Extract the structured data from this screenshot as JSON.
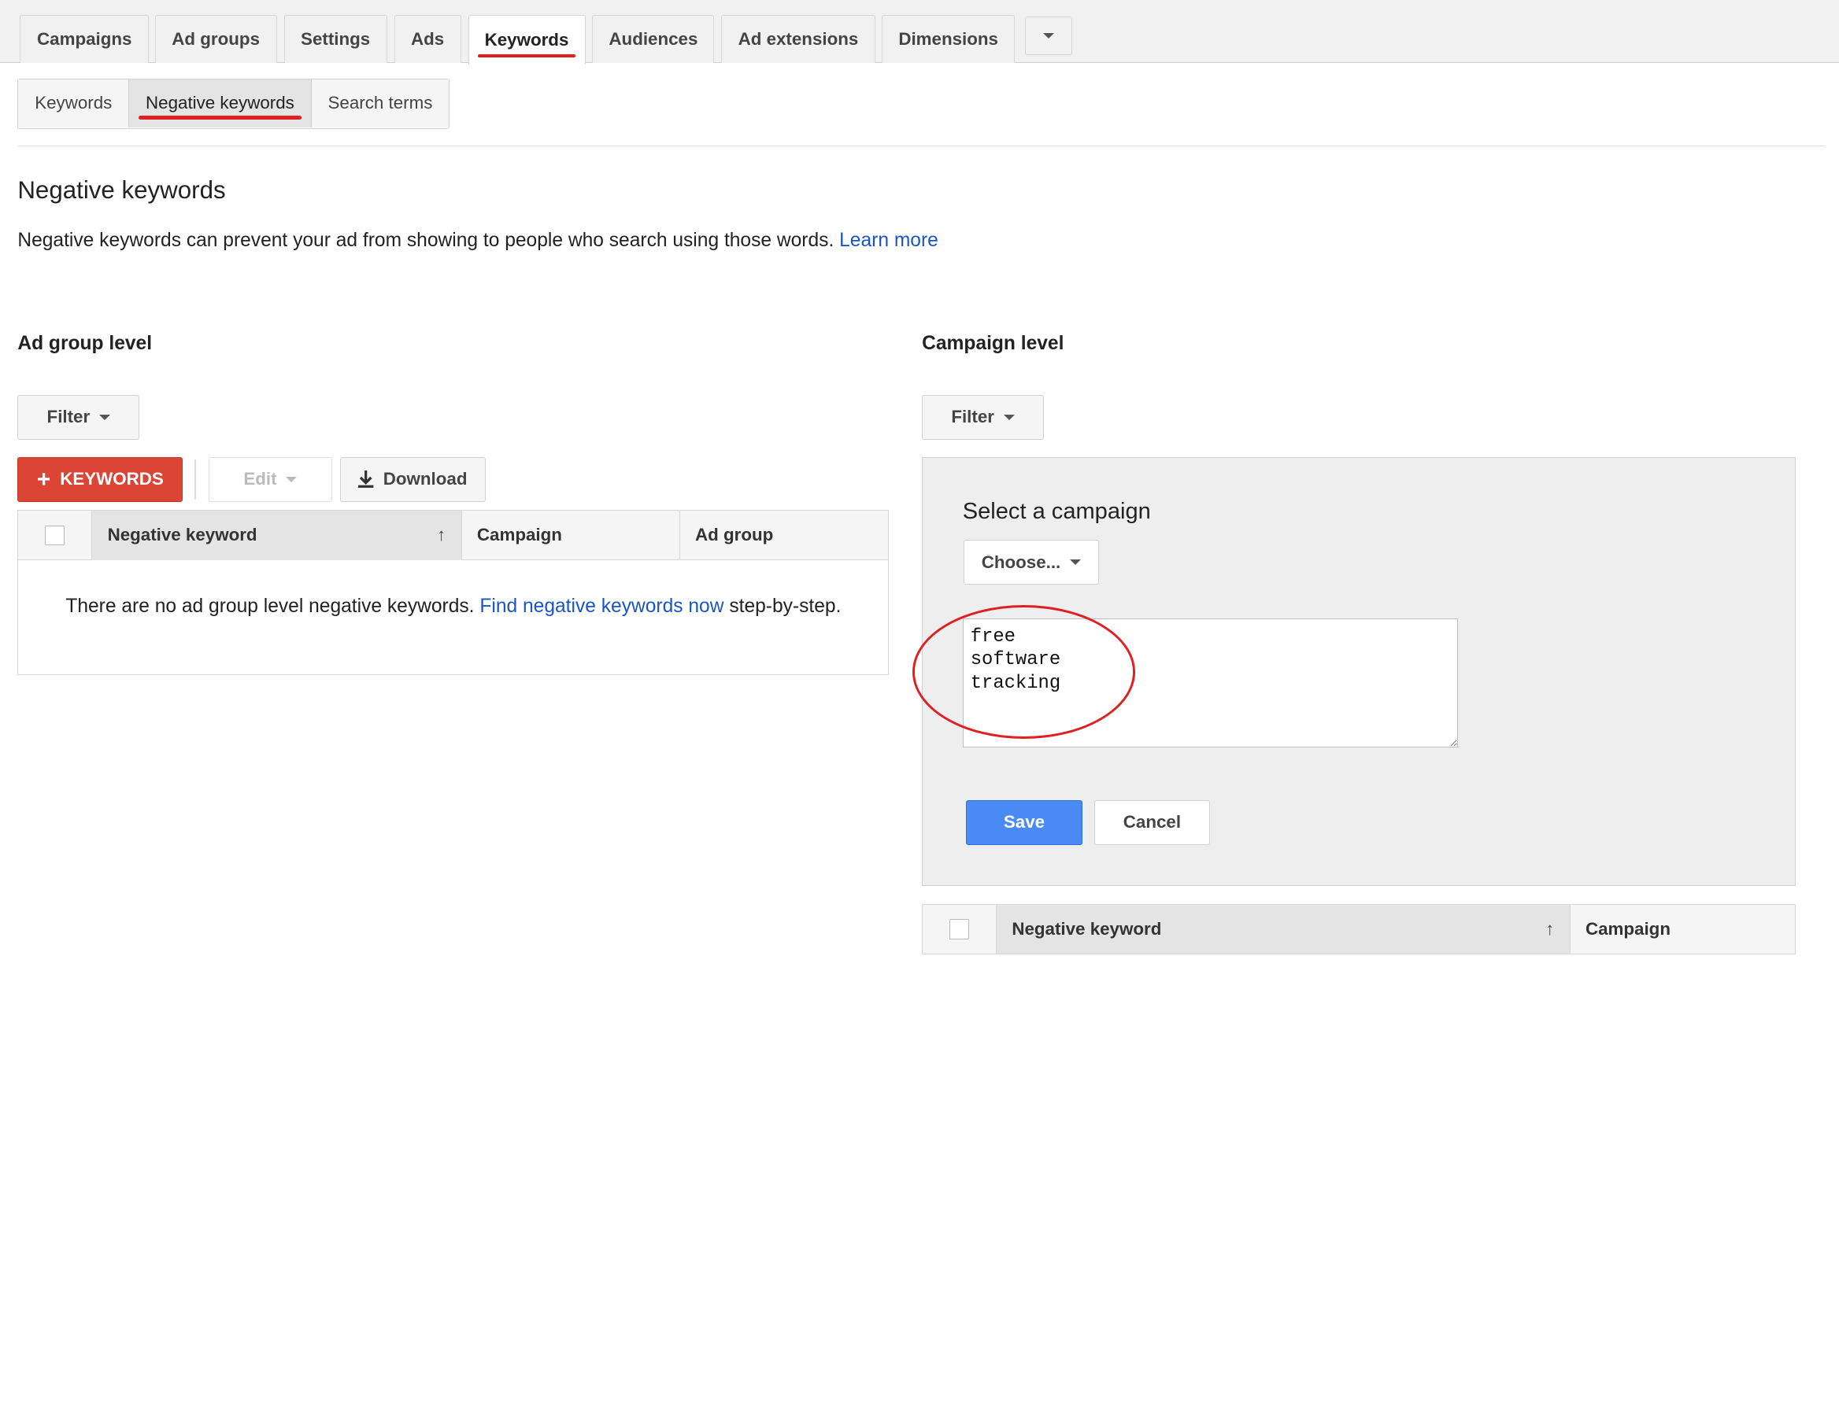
{
  "tabs": [
    {
      "label": "Campaigns"
    },
    {
      "label": "Ad groups"
    },
    {
      "label": "Settings"
    },
    {
      "label": "Ads"
    },
    {
      "label": "Keywords"
    },
    {
      "label": "Audiences"
    },
    {
      "label": "Ad extensions"
    },
    {
      "label": "Dimensions"
    }
  ],
  "active_tab": "Keywords",
  "more_tab_icon": "chevron-down-icon",
  "subtabs": [
    {
      "label": "Keywords"
    },
    {
      "label": "Negative keywords"
    },
    {
      "label": "Search terms"
    }
  ],
  "active_subtab": "Negative keywords",
  "page": {
    "title": "Negative keywords",
    "description": "Negative keywords can prevent your ad from showing to people who search using those words.",
    "learn_more": "Learn more"
  },
  "ad_group_level": {
    "title": "Ad group level",
    "filter_label": "Filter",
    "add_keywords_label": "KEYWORDS",
    "edit_label": "Edit",
    "download_label": "Download",
    "columns": [
      "Negative keyword",
      "Campaign",
      "Ad group"
    ],
    "empty_message_before": "There are no ad group level negative keywords.",
    "empty_message_link": "Find negative keywords now",
    "empty_message_after": "step-by-step."
  },
  "campaign_level": {
    "title": "Campaign level",
    "filter_label": "Filter",
    "select_title": "Select a campaign",
    "choose_label": "Choose...",
    "keywords_text": "free\nsoftware\ntracking",
    "save_label": "Save",
    "cancel_label": "Cancel",
    "columns": [
      "Negative keyword",
      "Campaign"
    ]
  },
  "colors": {
    "accent_red": "#e02020",
    "add_button": "#dc4535",
    "save_button": "#4a8af4",
    "link": "#1a55c6"
  }
}
